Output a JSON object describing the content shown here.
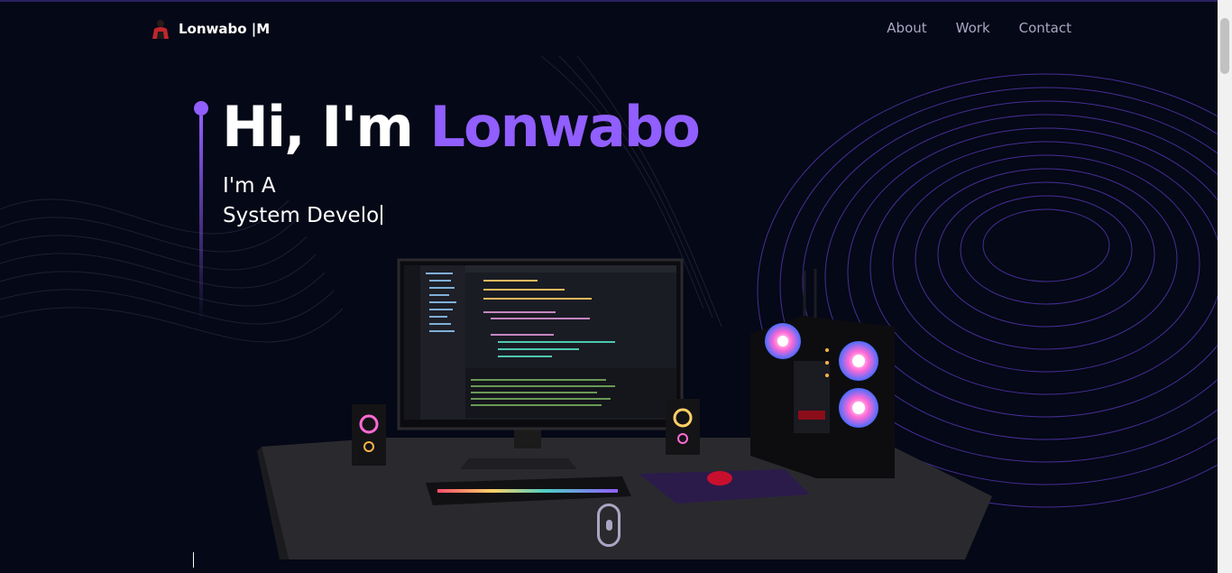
{
  "nav": {
    "brand": "Lonwabo |M",
    "links": [
      "About",
      "Work",
      "Contact"
    ]
  },
  "hero": {
    "greeting": "Hi, I'm ",
    "name": "Lonwabo",
    "line1": "I'm A",
    "line2": "System Develo"
  },
  "colors": {
    "background": "#050816",
    "accent": "#915eff",
    "nav_text": "#aaa6c3"
  },
  "icons": [
    "avatar-icon",
    "scroll-down-icon"
  ]
}
